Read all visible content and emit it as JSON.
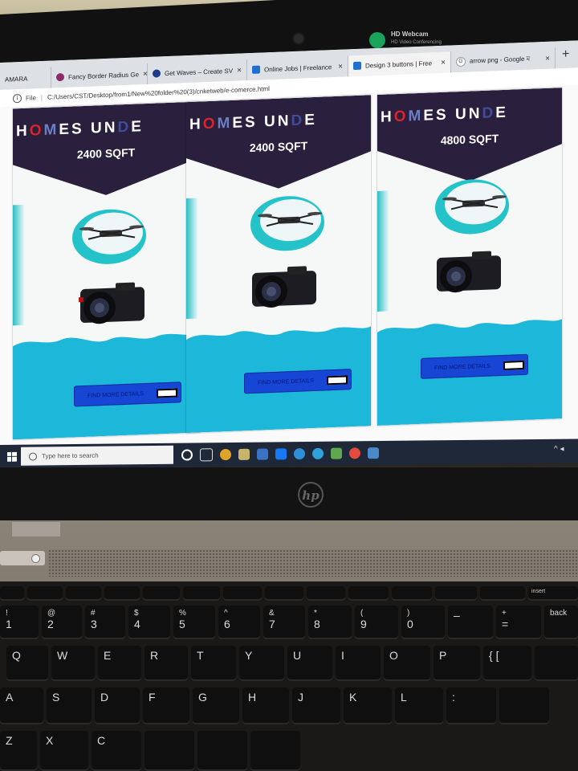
{
  "webcam": {
    "title": "HD Webcam",
    "subtitle": "HD Video Conferencing"
  },
  "browser": {
    "tabs": [
      {
        "label": "AMARA",
        "favicon_color": "#dddddd"
      },
      {
        "label": "Fancy Border Radius Ge",
        "favicon_color": "#8a2b6b"
      },
      {
        "label": "Get Waves – Create SV",
        "favicon_color": "#1e3a8a"
      },
      {
        "label": "Online Jobs | Freelance",
        "favicon_color": "#1f6fd1"
      },
      {
        "label": "Design 3 buttons | Free",
        "favicon_color": "#1f6fd1"
      },
      {
        "label": "arrow png - Google ম",
        "favicon_color": "#ffffff"
      }
    ],
    "address": {
      "scheme": "File",
      "url": "C:/Users/CST/Desktop/from1/New%20folder%20(3)/cnketweb/e-comerce.html"
    }
  },
  "cards": [
    {
      "title": "HOMES UNDE",
      "size": "2400 SQFT",
      "button": "FIND MORE DETAILS"
    },
    {
      "title": "HOMES UNDE",
      "size": "2400 SQFT",
      "button": "FIND MORE DETAILS"
    },
    {
      "title": "HOMES UNDE",
      "size": "4800 SQFT",
      "button": "FIND MORE DETAILS"
    }
  ],
  "colors": {
    "banner": "#2a1f3d",
    "wave": "#1db7d9",
    "blob": "#23c3c9",
    "button": "#1746d4"
  },
  "taskbar": {
    "search_placeholder": "Type here to search"
  },
  "laptop": {
    "brand": "hp"
  },
  "keyboard": {
    "number_row": [
      {
        "top": "!",
        "main": "1"
      },
      {
        "top": "@",
        "main": "2"
      },
      {
        "top": "#",
        "main": "3"
      },
      {
        "top": "$",
        "main": "4"
      },
      {
        "top": "%",
        "main": "5"
      },
      {
        "top": "^",
        "main": "6"
      },
      {
        "top": "&",
        "main": "7"
      },
      {
        "top": "*",
        "main": "8"
      },
      {
        "top": "(",
        "main": "9"
      },
      {
        "top": ")",
        "main": "0"
      },
      {
        "top": "",
        "main": "–"
      },
      {
        "top": "+",
        "main": "="
      }
    ],
    "qwerty_row": [
      "Q",
      "W",
      "E",
      "R",
      "T",
      "Y",
      "U",
      "I",
      "O",
      "P",
      "{ ["
    ],
    "asdf_row": [
      "A",
      "S",
      "D",
      "F",
      "G",
      "H",
      "J",
      "K",
      "L",
      ":",
      ""
    ],
    "zx_row": [
      "Z",
      "X",
      "C"
    ],
    "fn_right": "insert",
    "backspace": "back"
  }
}
